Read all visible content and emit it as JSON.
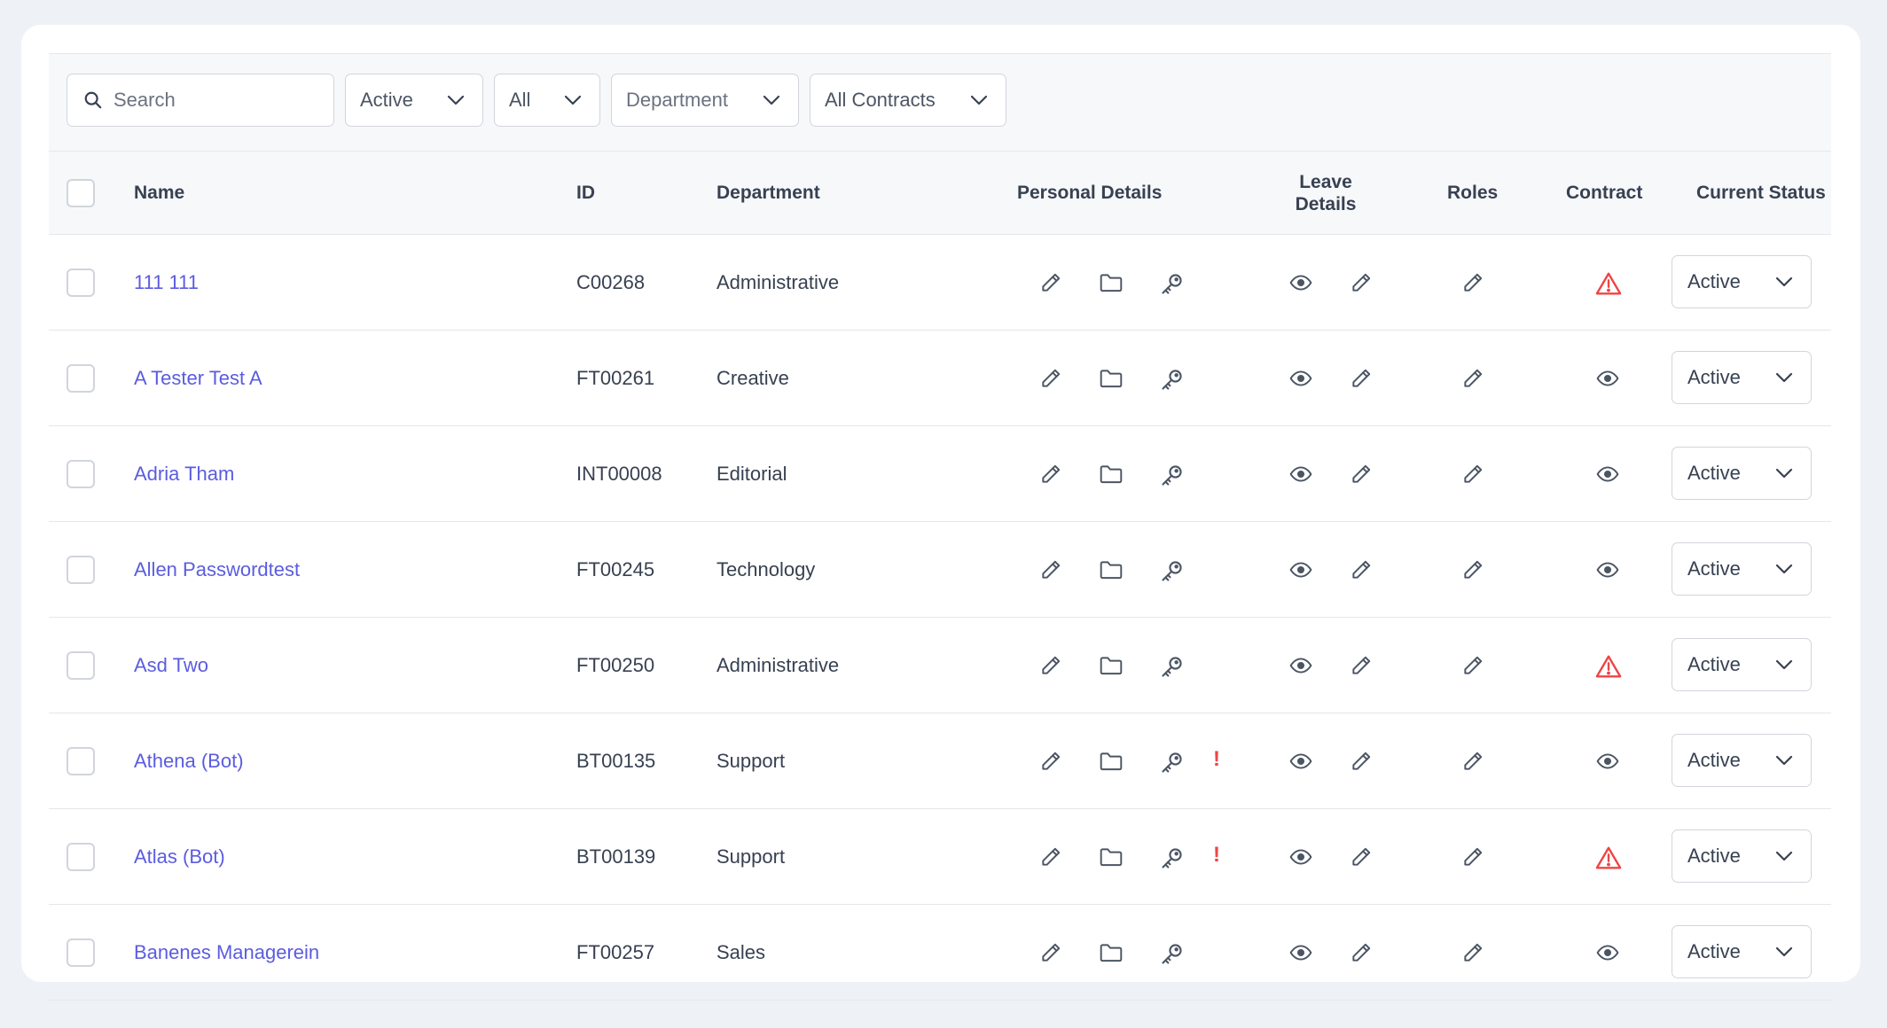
{
  "filters": {
    "search_placeholder": "Search",
    "status_value": "Active",
    "type_value": "All",
    "department_placeholder": "Department",
    "contracts_value": "All Contracts"
  },
  "table": {
    "headers": {
      "name": "Name",
      "id": "ID",
      "department": "Department",
      "personal_details": "Personal Details",
      "leave_details_line1": "Leave",
      "leave_details_line2": "Details",
      "roles": "Roles",
      "contract": "Contract",
      "current_status": "Current Status"
    },
    "rows": [
      {
        "name": "111 111",
        "id": "C00268",
        "department": "Administrative",
        "personal_alert": false,
        "contract_icon": "warning-icon",
        "status": "Active"
      },
      {
        "name": "A Tester Test A",
        "id": "FT00261",
        "department": "Creative",
        "personal_alert": false,
        "contract_icon": "eye-icon",
        "status": "Active"
      },
      {
        "name": "Adria Tham",
        "id": "INT00008",
        "department": "Editorial",
        "personal_alert": false,
        "contract_icon": "eye-icon",
        "status": "Active"
      },
      {
        "name": "Allen Passwordtest",
        "id": "FT00245",
        "department": "Technology",
        "personal_alert": false,
        "contract_icon": "eye-icon",
        "status": "Active"
      },
      {
        "name": "Asd Two",
        "id": "FT00250",
        "department": "Administrative",
        "personal_alert": false,
        "contract_icon": "warning-icon",
        "status": "Active"
      },
      {
        "name": "Athena (Bot)",
        "id": "BT00135",
        "department": "Support",
        "personal_alert": true,
        "alert_text": "!",
        "contract_icon": "eye-icon",
        "status": "Active"
      },
      {
        "name": "Atlas (Bot)",
        "id": "BT00139",
        "department": "Support",
        "personal_alert": true,
        "alert_text": "!",
        "contract_icon": "warning-icon",
        "status": "Active"
      },
      {
        "name": "Banenes Managerein",
        "id": "FT00257",
        "department": "Sales",
        "personal_alert": false,
        "contract_icon": "eye-icon",
        "status": "Active"
      }
    ]
  },
  "colors": {
    "link": "#5b5ce0",
    "icon": "#4b5563",
    "alert": "#ef4444",
    "header_bg": "#f7f8fa",
    "page_bg": "#eef1f6"
  }
}
